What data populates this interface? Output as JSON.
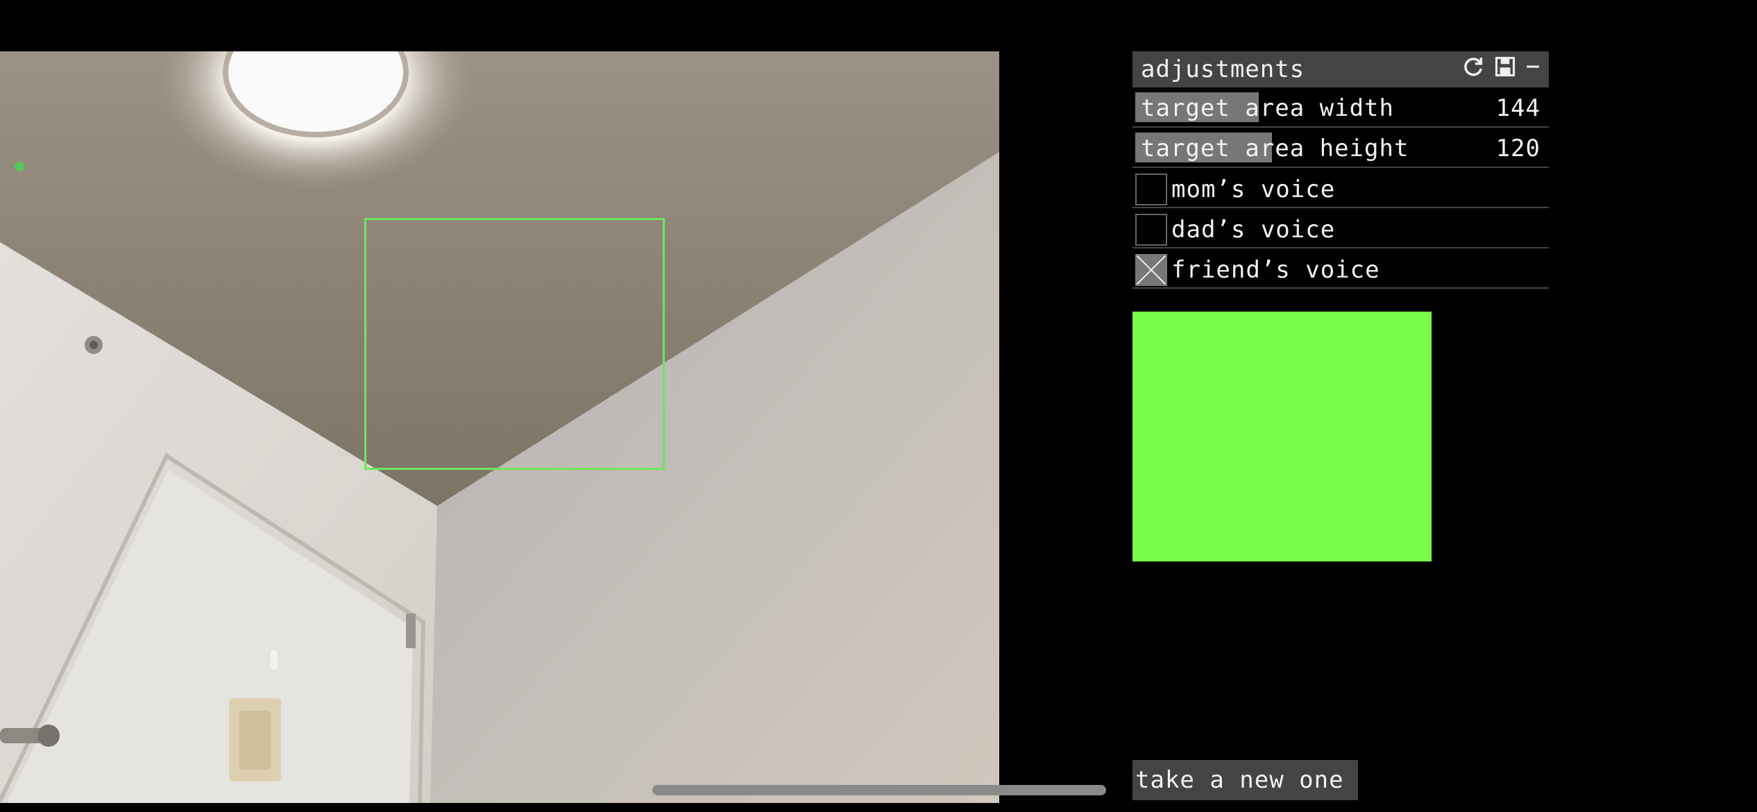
{
  "panel": {
    "title": "adjustments",
    "icons": [
      "refresh-icon",
      "save-icon",
      "minimize-icon"
    ],
    "sliders": [
      {
        "label": "target area width",
        "value": "144",
        "fill_fraction": 0.3
      },
      {
        "label": "target area height",
        "value": "120",
        "fill_fraction": 0.33
      }
    ],
    "toggles": [
      {
        "label": "mom’s voice",
        "checked": false
      },
      {
        "label": "dad’s voice",
        "checked": false
      },
      {
        "label": "friend’s voice",
        "checked": true
      }
    ]
  },
  "preview": {
    "color": "#77fb4c"
  },
  "actions": {
    "take_new_label": "take a new one"
  },
  "colors": {
    "accent_green": "#6be85a",
    "panel_bg": "#444444"
  }
}
